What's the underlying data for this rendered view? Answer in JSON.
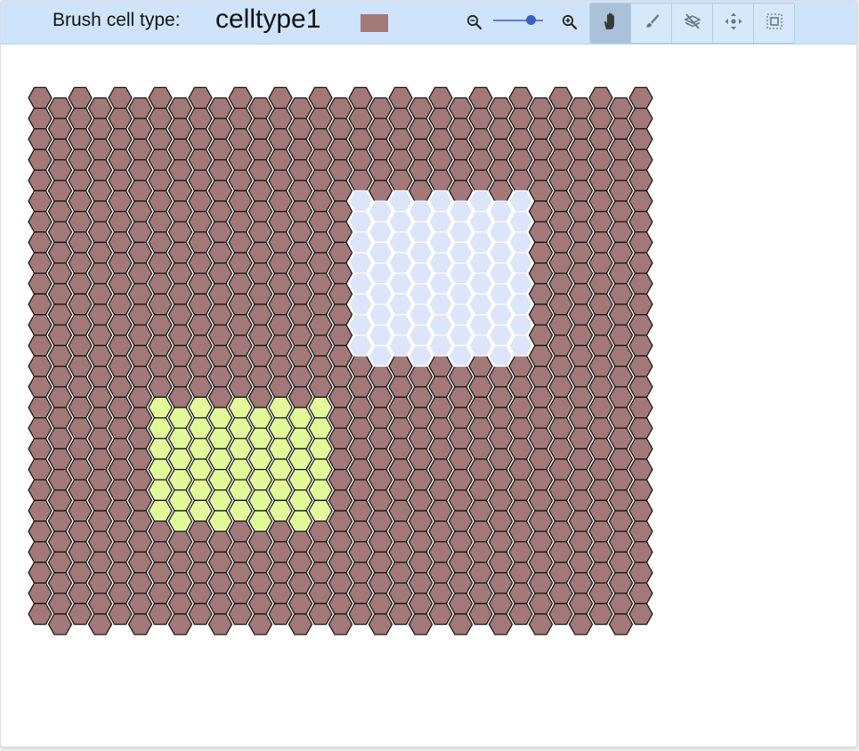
{
  "toolbar": {
    "brush_label": "Brush cell type:",
    "brush_cell_type": "celltype1",
    "brush_color": "#a37878",
    "zoom": {
      "out_icon": "zoom-out-icon",
      "in_icon": "zoom-in-icon",
      "level": 0.75
    },
    "tools": [
      {
        "name": "pan",
        "icon": "hand-icon",
        "active": true
      },
      {
        "name": "brush",
        "icon": "brush-icon",
        "active": false
      },
      {
        "name": "erase",
        "icon": "eraser-icon",
        "active": false
      },
      {
        "name": "move",
        "icon": "move-arrows-icon",
        "active": false
      },
      {
        "name": "select",
        "icon": "selection-icon",
        "active": false
      }
    ]
  },
  "grid": {
    "columns": 31,
    "rows": 26,
    "colors": {
      "celltype1": "#a37878",
      "region_light": "#dde5fa",
      "region_lime": "#e3fa9b",
      "cell_stroke": "#111111",
      "light_stroke": "#ffffff"
    },
    "regions": [
      {
        "type": "region_light",
        "col_start": 16,
        "col_end": 24,
        "row_start": 5,
        "row_end": 12
      },
      {
        "type": "region_lime",
        "col_start": 6,
        "col_end": 14,
        "row_start": 15,
        "row_end": 20
      }
    ]
  }
}
